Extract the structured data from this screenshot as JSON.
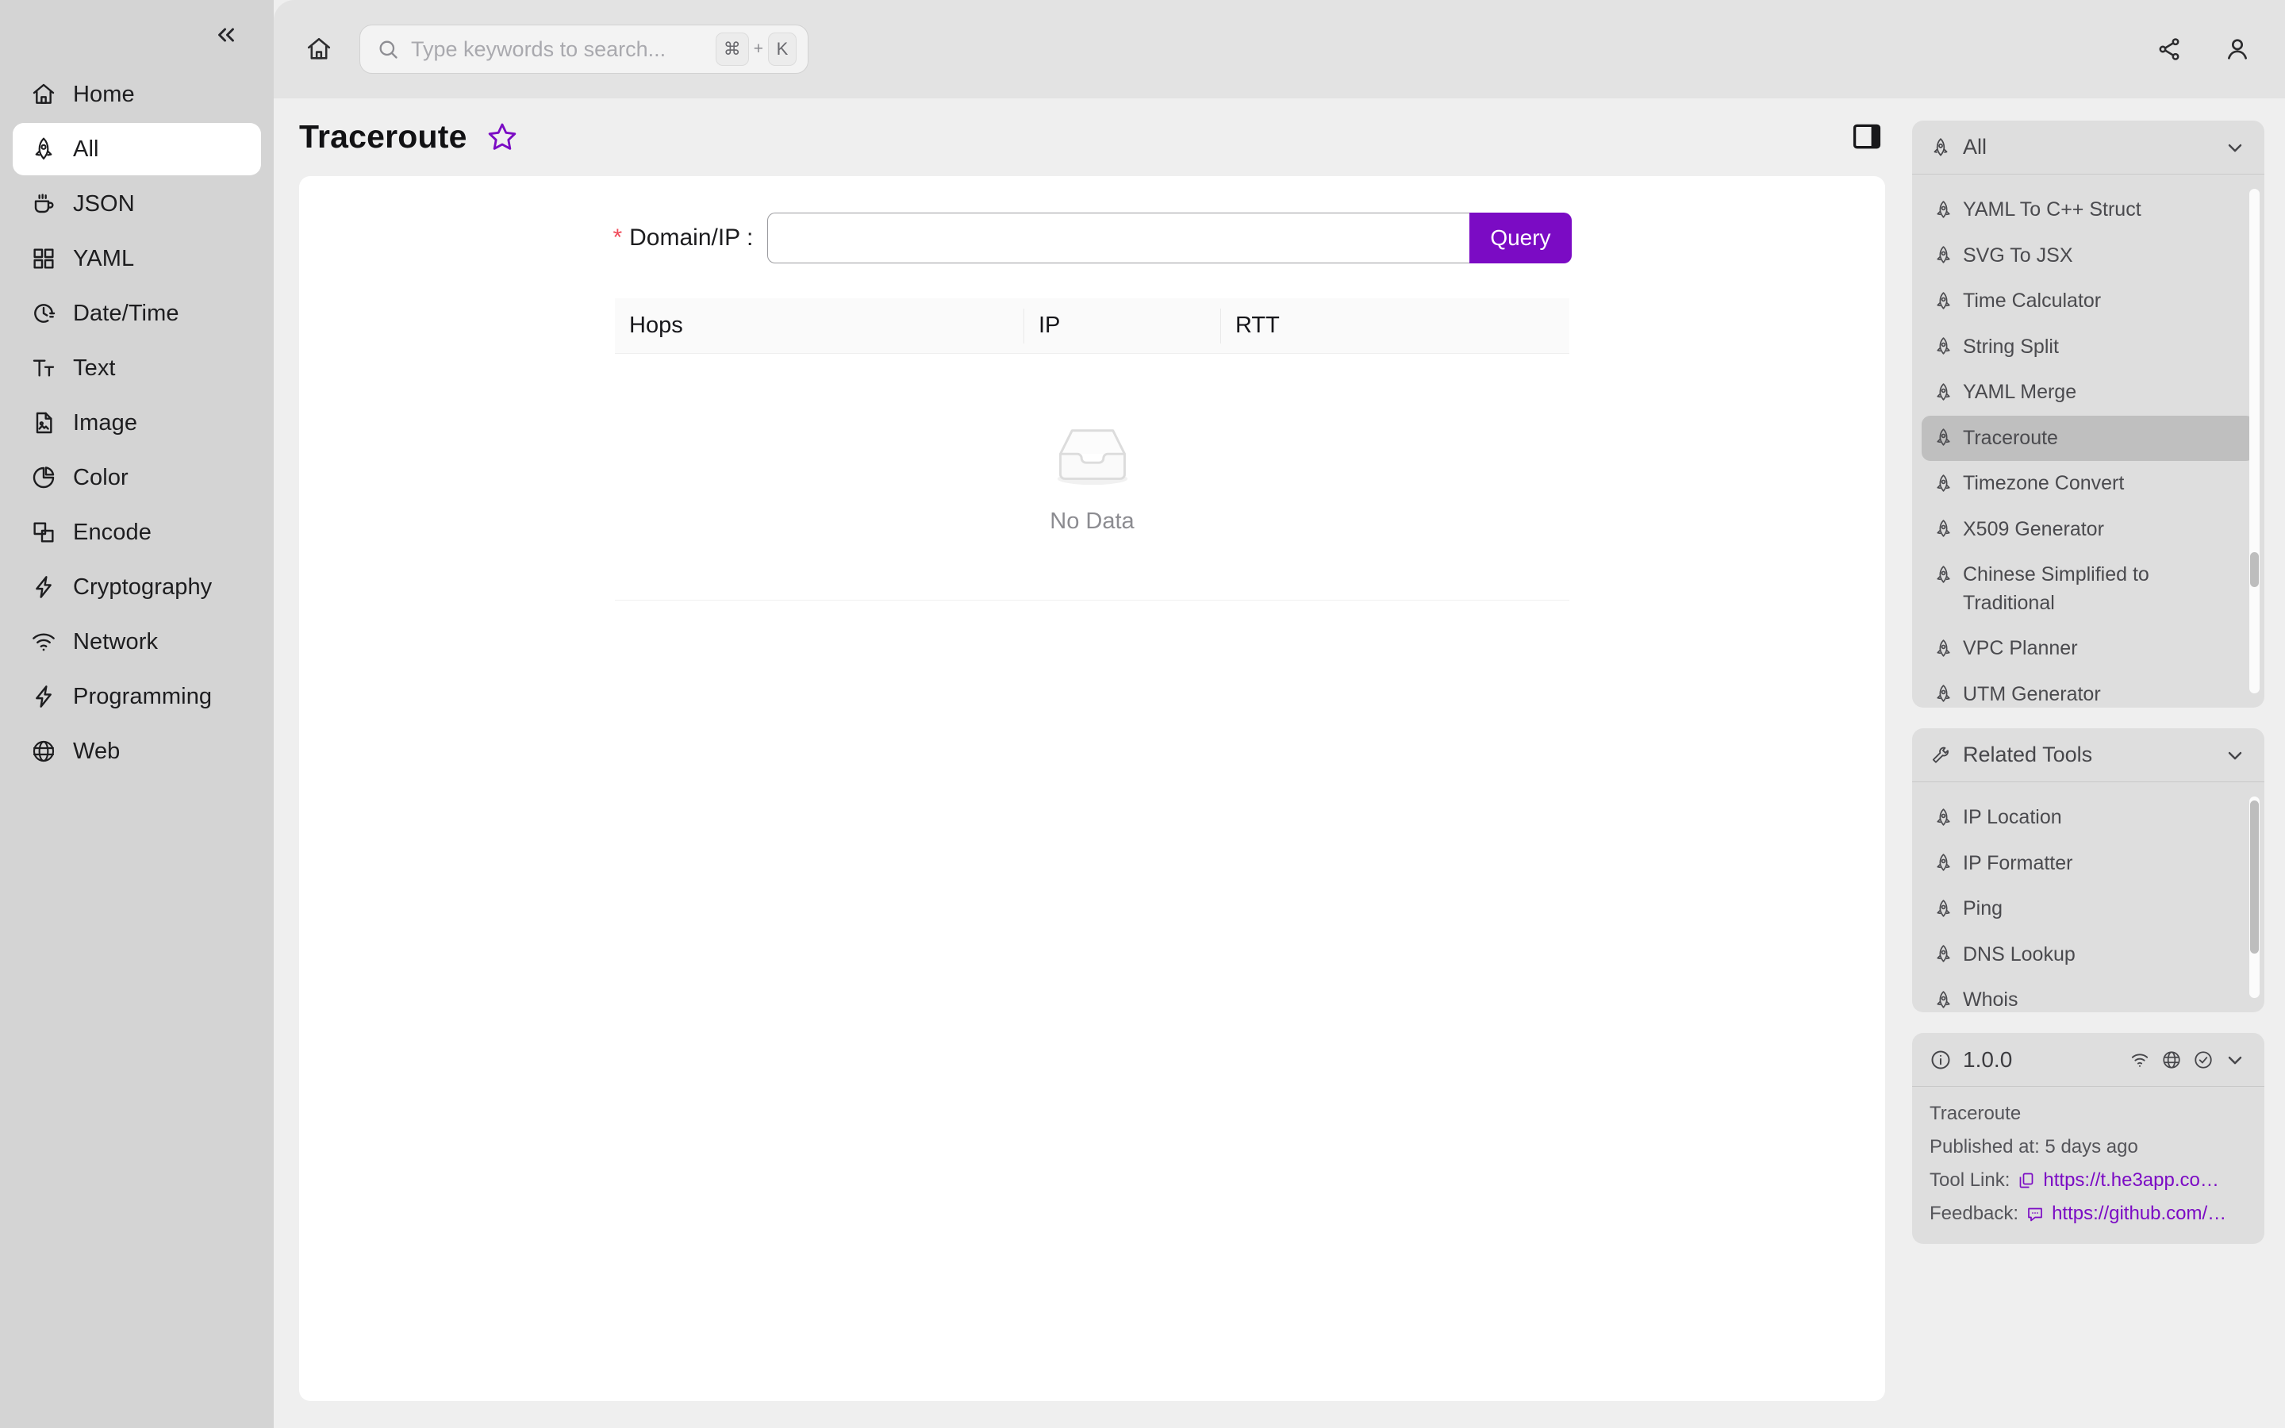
{
  "sidebar": {
    "collapse_icon": "chevrons-left-icon",
    "items": [
      {
        "label": "Home",
        "icon": "home-icon",
        "active": false
      },
      {
        "label": "All",
        "icon": "rocket-icon",
        "active": true
      },
      {
        "label": "JSON",
        "icon": "coffee-cup-icon",
        "active": false
      },
      {
        "label": "YAML",
        "icon": "grid-icon",
        "active": false
      },
      {
        "label": "Date/Time",
        "icon": "clock-icon",
        "active": false
      },
      {
        "label": "Text",
        "icon": "text-size-icon",
        "active": false
      },
      {
        "label": "Image",
        "icon": "image-file-icon",
        "active": false
      },
      {
        "label": "Color",
        "icon": "pie-chart-icon",
        "active": false
      },
      {
        "label": "Encode",
        "icon": "layers-icon",
        "active": false
      },
      {
        "label": "Cryptography",
        "icon": "bolt-icon",
        "active": false
      },
      {
        "label": "Network",
        "icon": "wifi-icon",
        "active": false
      },
      {
        "label": "Programming",
        "icon": "bolt-icon",
        "active": false
      },
      {
        "label": "Web",
        "icon": "globe-icon",
        "active": false
      }
    ]
  },
  "topbar": {
    "home_icon": "home-icon",
    "search": {
      "icon": "search-icon",
      "placeholder": "Type keywords to search...",
      "value": "",
      "shortcut_key": "⌘",
      "shortcut_plus": "+",
      "shortcut_letter": "K"
    },
    "share_icon": "share-icon",
    "account_icon": "user-icon"
  },
  "page": {
    "title": "Traceroute",
    "favorite_icon": "star-outline-icon",
    "favorite_color": "#7b0bc4",
    "panel_toggle_icon": "right-panel-toggle-icon"
  },
  "form": {
    "required_marker": "*",
    "label": "Domain/IP :",
    "input_value": "",
    "input_placeholder": "",
    "submit_label": "Query",
    "submit_color": "#7b0bc4"
  },
  "table": {
    "columns": [
      "Hops",
      "IP",
      "RTT"
    ],
    "rows": [],
    "empty_state": {
      "icon": "empty-box-icon",
      "text": "No Data"
    }
  },
  "right_panel": {
    "all_section": {
      "icon": "rocket-icon",
      "title": "All",
      "chevron": "chevron-down-icon",
      "items": [
        {
          "label": "YAML To C++ Struct",
          "selected": false
        },
        {
          "label": "SVG To JSX",
          "selected": false
        },
        {
          "label": "Time Calculator",
          "selected": false
        },
        {
          "label": "String Split",
          "selected": false
        },
        {
          "label": "YAML Merge",
          "selected": false
        },
        {
          "label": "Traceroute",
          "selected": true
        },
        {
          "label": "Timezone Convert",
          "selected": false
        },
        {
          "label": "X509 Generator",
          "selected": false
        },
        {
          "label": "Chinese Simplified to Traditional",
          "selected": false
        },
        {
          "label": "VPC Planner",
          "selected": false
        },
        {
          "label": "UTM Generator",
          "selected": false
        }
      ]
    },
    "related_section": {
      "icon": "wrench-icon",
      "title": "Related Tools",
      "chevron": "chevron-down-icon",
      "items": [
        {
          "label": "IP Location",
          "selected": false
        },
        {
          "label": "IP Formatter",
          "selected": false
        },
        {
          "label": "Ping",
          "selected": false
        },
        {
          "label": "DNS Lookup",
          "selected": false
        },
        {
          "label": "Whois",
          "selected": false
        }
      ]
    },
    "info_card": {
      "info_icon": "info-circle-icon",
      "version": "1.0.0",
      "status_icons": [
        "wifi-icon",
        "globe-icon",
        "check-circle-icon",
        "chevron-down-icon"
      ],
      "tool_name": "Traceroute",
      "published_label": "Published at: 5 days ago",
      "tool_link_label": "Tool Link:",
      "tool_link_icon": "copy-icon",
      "tool_link_url": "https://t.he3app.co…",
      "feedback_label": "Feedback:",
      "feedback_icon": "comment-icon",
      "feedback_url": "https://github.com/…",
      "link_color": "#7b0bc4"
    }
  }
}
